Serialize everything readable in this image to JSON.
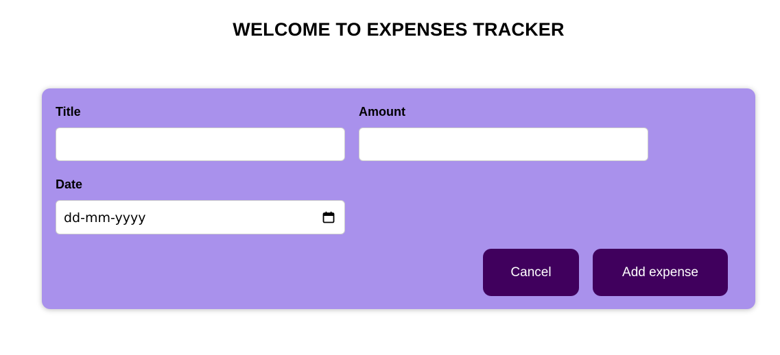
{
  "header": {
    "title": "WELCOME TO EXPENSES TRACKER"
  },
  "form": {
    "title_field": {
      "label": "Title",
      "value": ""
    },
    "amount_field": {
      "label": "Amount",
      "value": ""
    },
    "date_field": {
      "label": "Date",
      "placeholder": "dd-mm-yyyy"
    },
    "actions": {
      "cancel_label": "Cancel",
      "add_label": "Add expense"
    }
  },
  "colors": {
    "card_background": "#a991ec",
    "button_background": "#40005d",
    "button_text": "#ffffff"
  },
  "icons": {
    "date_picker": "calendar-icon"
  }
}
